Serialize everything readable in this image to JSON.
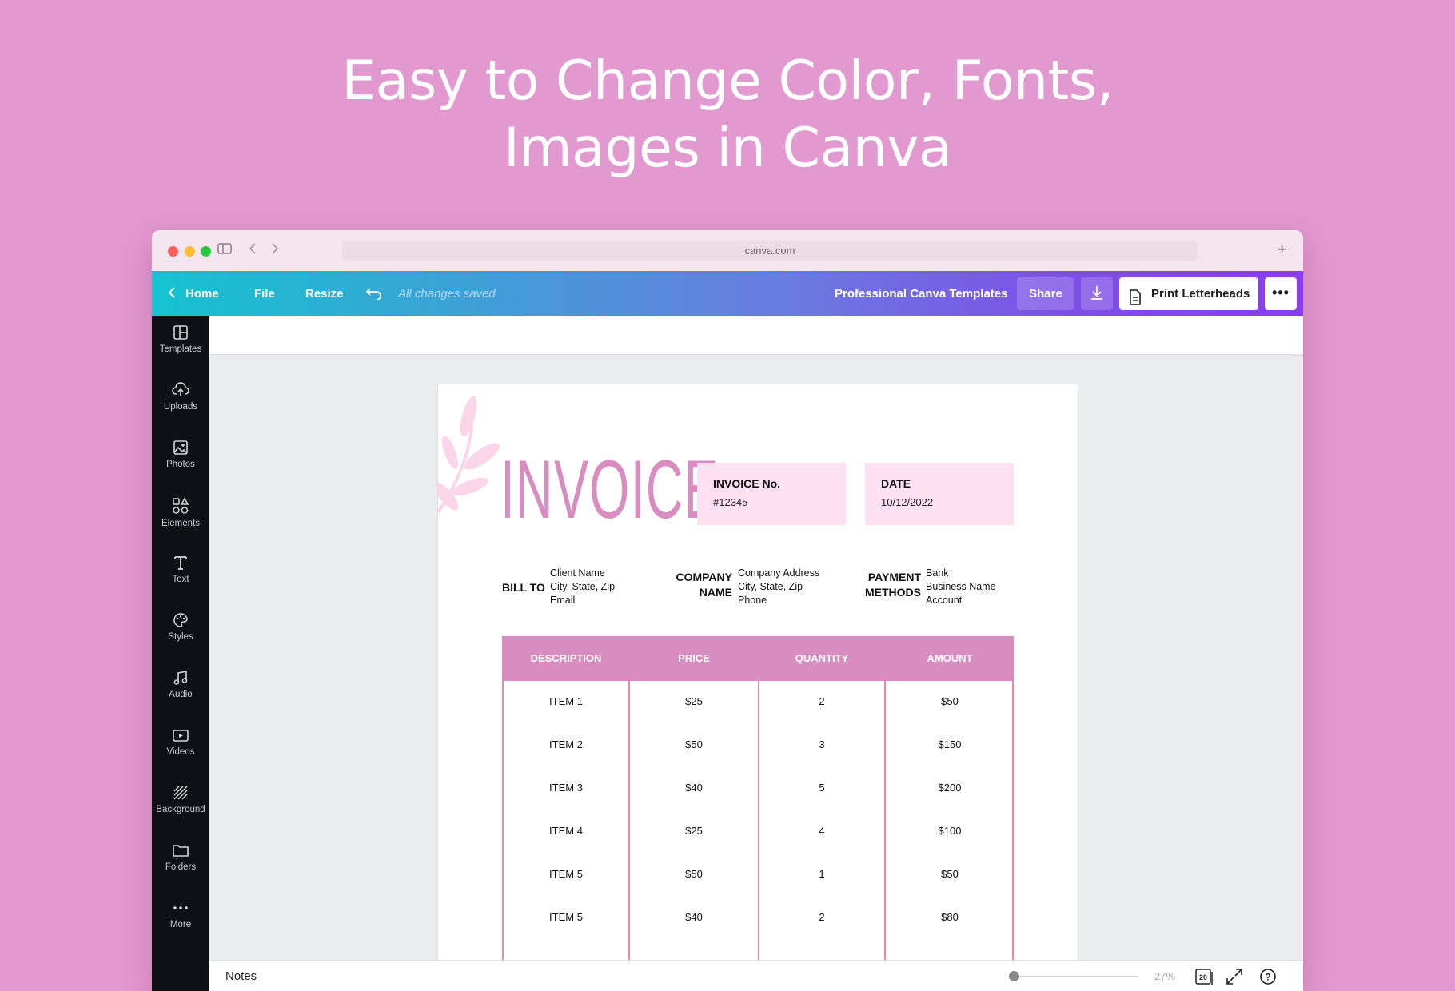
{
  "headline": {
    "line1": "Easy to Change Color, Fonts,",
    "line2": "Images in Canva"
  },
  "browser": {
    "url": "canva.com",
    "new_tab_icon": "plus-icon"
  },
  "toolbar": {
    "home": "Home",
    "file": "File",
    "resize": "Resize",
    "status": "All changes saved",
    "doc_title": "Professional Canva Templates",
    "share": "Share",
    "print": "Print Letterheads",
    "more": "•••"
  },
  "sidebar": {
    "items": [
      {
        "label": "Templates",
        "icon": "templates-icon"
      },
      {
        "label": "Uploads",
        "icon": "cloud-upload-icon"
      },
      {
        "label": "Photos",
        "icon": "photo-icon"
      },
      {
        "label": "Elements",
        "icon": "shapes-icon"
      },
      {
        "label": "Text",
        "icon": "text-icon"
      },
      {
        "label": "Styles",
        "icon": "palette-icon"
      },
      {
        "label": "Audio",
        "icon": "music-note-icon"
      },
      {
        "label": "Videos",
        "icon": "video-icon"
      },
      {
        "label": "Background",
        "icon": "background-pattern-icon"
      },
      {
        "label": "Folders",
        "icon": "folder-icon"
      },
      {
        "label": "More",
        "icon": "more-dots-icon"
      }
    ]
  },
  "invoice": {
    "title": "INVOICE",
    "number_label": "INVOICE No.",
    "number_value": "#12345",
    "date_label": "DATE",
    "date_value": "10/12/2022",
    "bill_to_label": "BILL TO",
    "bill_to_lines": [
      "Client Name",
      "City, State, Zip",
      "Email"
    ],
    "company_label_1": "COMPANY",
    "company_label_2": "NAME",
    "company_lines": [
      "Company Address",
      "City, State, Zip",
      "Phone"
    ],
    "payment_label_1": "PAYMENT",
    "payment_label_2": "METHODS",
    "payment_lines": [
      "Bank",
      "Business Name",
      "Account"
    ],
    "columns": [
      "DESCRIPTION",
      "PRICE",
      "QUANTITY",
      "AMOUNT"
    ],
    "rows": [
      [
        "ITEM 1",
        "$25",
        "2",
        "$50"
      ],
      [
        "ITEM 2",
        "$50",
        "3",
        "$150"
      ],
      [
        "ITEM 3",
        "$40",
        "5",
        "$200"
      ],
      [
        "ITEM 4",
        "$25",
        "4",
        "$100"
      ],
      [
        "ITEM 5",
        "$50",
        "1",
        "$50"
      ],
      [
        "ITEM 5",
        "$40",
        "2",
        "$80"
      ]
    ],
    "accent_color": "#d98cbf",
    "box_color": "#fde1f2"
  },
  "bottom": {
    "notes": "Notes",
    "zoom": "27%",
    "page_count": "20"
  },
  "colors": {
    "background": "#e299cf",
    "sidebar": "#0f1015",
    "gradient_start": "#14c3cf",
    "gradient_end": "#8b3cf0"
  }
}
